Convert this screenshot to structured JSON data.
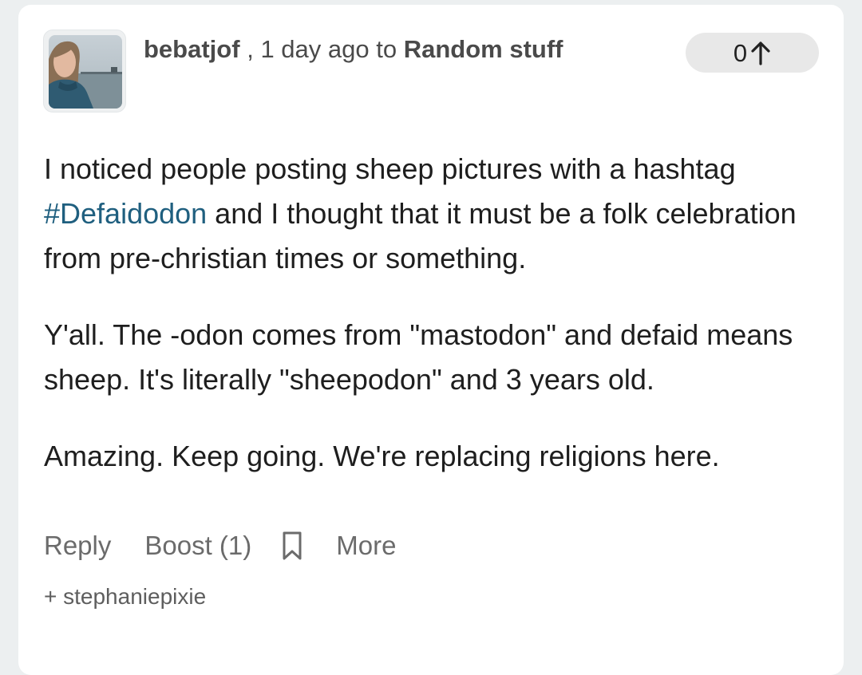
{
  "post": {
    "author": "bebatjof",
    "separator": ",",
    "time_ago": "1 day ago",
    "to_word": "to",
    "community": "Random stuff",
    "vote_count": "0",
    "paragraphs": [
      {
        "before": "I noticed people posting sheep pictures with a hashtag ",
        "hashtag": "#Defaidodon",
        "after": " and I thought that it must be a folk celebration from pre-christian times or something."
      },
      {
        "text": "Y'all. The -odon comes from \"mastodon\" and defaid means sheep. It's literally \"sheepodon\" and 3 years old."
      },
      {
        "text": "Amazing. Keep going. We're replacing religions here."
      }
    ]
  },
  "actions": {
    "reply_label": "Reply",
    "boost_label": "Boost (1)",
    "more_label": "More"
  },
  "boosted_by": "+ stephaniepixie",
  "icons": {
    "vote": "arrow-up-icon",
    "bookmark": "bookmark-icon"
  },
  "colors": {
    "background": "#eceff0",
    "card": "#ffffff",
    "hashtag": "#1f5f7f",
    "vote_pill": "#e8e8e8",
    "muted_text": "#6b6b6b"
  }
}
